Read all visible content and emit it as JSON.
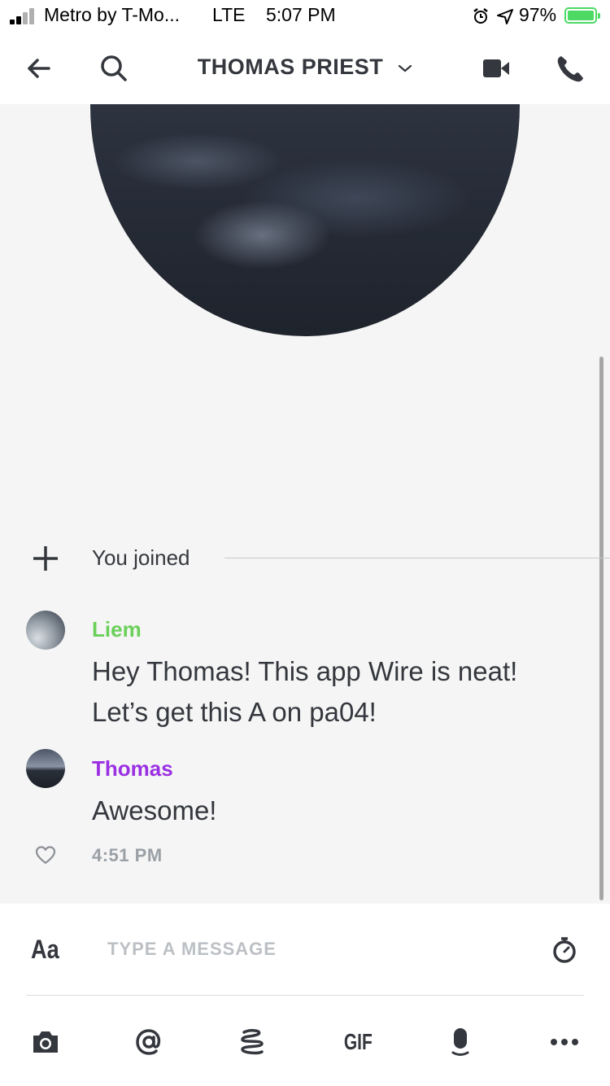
{
  "status_bar": {
    "carrier": "Metro by T-Mo...",
    "network": "LTE",
    "time": "5:07 PM",
    "battery": "97%",
    "battery_color": "#4cd964",
    "signal_bars_active": 2
  },
  "header": {
    "title": "THOMAS PRIEST",
    "back_icon": "arrow-left-icon",
    "search_icon": "search-icon",
    "dropdown_icon": "chevron-down-icon",
    "video_icon": "video-camera-icon",
    "call_icon": "phone-icon"
  },
  "conversation": {
    "system_message": "You joined",
    "messages": [
      {
        "sender": "Liem",
        "sender_color": "#6ad05a",
        "text": "Hey Thomas! This app Wire is neat! Let’s get this A on pa04!"
      },
      {
        "sender": "Thomas",
        "sender_color": "#9b30e3",
        "text": "Awesome!",
        "timestamp": "4:51 PM"
      }
    ]
  },
  "composer": {
    "format_label": "Aa",
    "placeholder": "TYPE A MESSAGE",
    "timer_icon": "timer-icon",
    "toolbar": [
      {
        "name": "camera-icon"
      },
      {
        "name": "mention-icon"
      },
      {
        "name": "sketch-icon"
      },
      {
        "name": "gif-icon",
        "label": "GIF"
      },
      {
        "name": "microphone-icon"
      },
      {
        "name": "more-icon"
      }
    ]
  }
}
